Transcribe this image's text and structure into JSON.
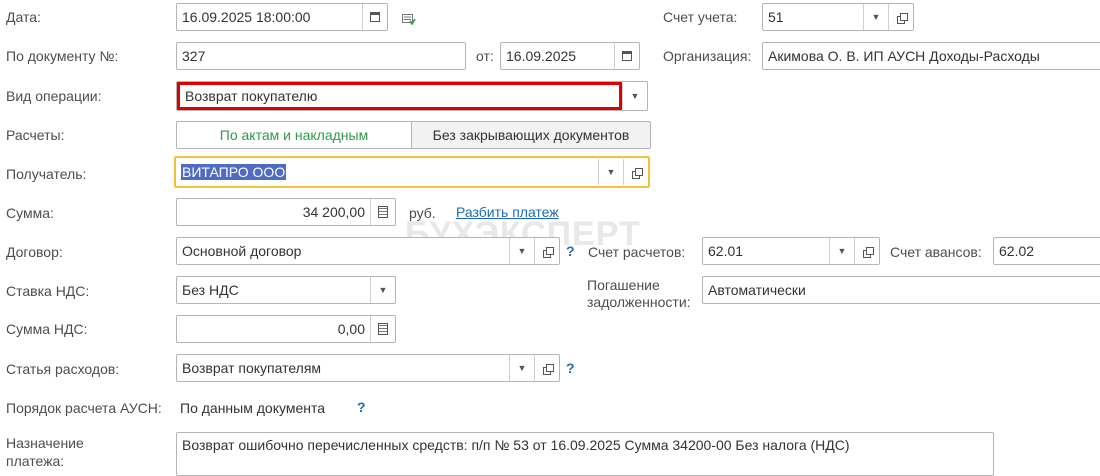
{
  "labels": {
    "date": "Дата:",
    "doc_no": "По документу №:",
    "from": "от:",
    "operation": "Вид операции:",
    "settlements": "Расчеты:",
    "recipient": "Получатель:",
    "sum": "Сумма:",
    "contract": "Договор:",
    "vat_rate": "Ставка НДС:",
    "vat_sum": "Сумма НДС:",
    "expense_item": "Статья расходов:",
    "ausn_order": "Порядок расчета АУСН:",
    "purpose_line1": "Назначение",
    "purpose_line2": "платежа:",
    "account": "Счет учета:",
    "organization": "Организация:",
    "settlement_account": "Счет расчетов:",
    "advance_account": "Счет авансов:",
    "repayment_line1": "Погашение",
    "repayment_line2": "задолженности:"
  },
  "values": {
    "date": "16.09.2025 18:00:00",
    "doc_no": "327",
    "from_date": "16.09.2025",
    "operation": "Возврат покупателю",
    "settlements_toggle_active": "По актам и накладным",
    "settlements_toggle_other": "Без закрывающих документов",
    "recipient": "ВИТАПРО ООО",
    "sum": "34 200,00",
    "currency": "руб.",
    "split_payment": "Разбить платеж",
    "contract": "Основной договор",
    "vat_rate": "Без НДС",
    "vat_sum": "0,00",
    "expense_item": "Возврат покупателям",
    "ausn_order": "По данным документа",
    "purpose": "Возврат ошибочно перечисленных средств: п/п № 53 от 16.09.2025 Сумма 34200-00 Без налога (НДС)",
    "account": "51",
    "organization": "Акимова О. В. ИП АУСН Доходы-Расходы",
    "settlement_account": "62.01",
    "advance_account": "62.02",
    "repayment": "Автоматически"
  },
  "help_mark": "?",
  "watermark": "БУХЭКСПЕРТ",
  "colors": {
    "highlight_red": "#e00000",
    "focus_yellow": "#f2c33a",
    "selection_blue": "#4f6bc4",
    "link_blue": "#1e6bb8",
    "active_green": "#2e9a4a"
  }
}
